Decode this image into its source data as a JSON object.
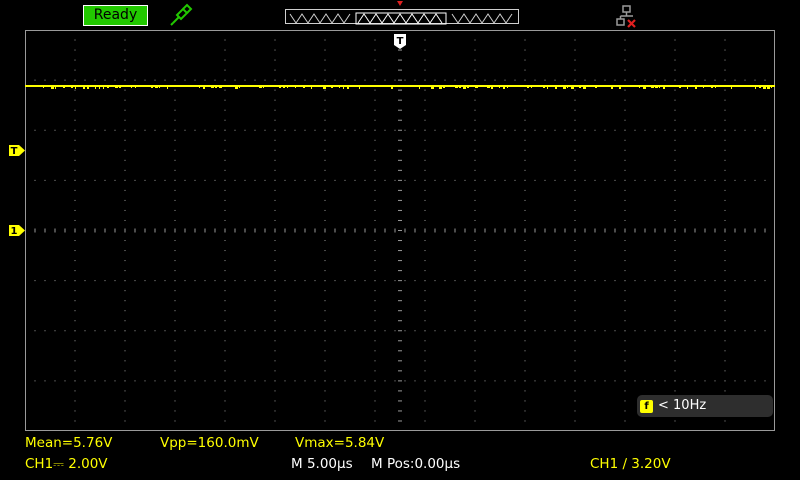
{
  "header": {
    "status": "Ready",
    "trigger_top_label": "T"
  },
  "screen": {
    "trigger_level_marker": "T",
    "channel_marker": "1",
    "frequency_icon": "f",
    "frequency_readout": "< 10Hz"
  },
  "measurements": {
    "mean": "Mean=5.76V",
    "vpp": "Vpp=160.0mV",
    "vmax": "Vmax=5.84V"
  },
  "statusbar": {
    "ch1_scale": "CH1⎓ 2.00V",
    "timebase": "M 5.00µs",
    "mpos": "M Pos:0.00µs",
    "trigger": "CH1 ∕ 3.20V"
  },
  "colors": {
    "trace": "#ffff00",
    "ready_bg": "#22c800",
    "grid": "#9a9a9a",
    "network_error": "#e02020"
  },
  "icons": {
    "probe": "probe-icon",
    "network": "network-disconnected-icon"
  }
}
